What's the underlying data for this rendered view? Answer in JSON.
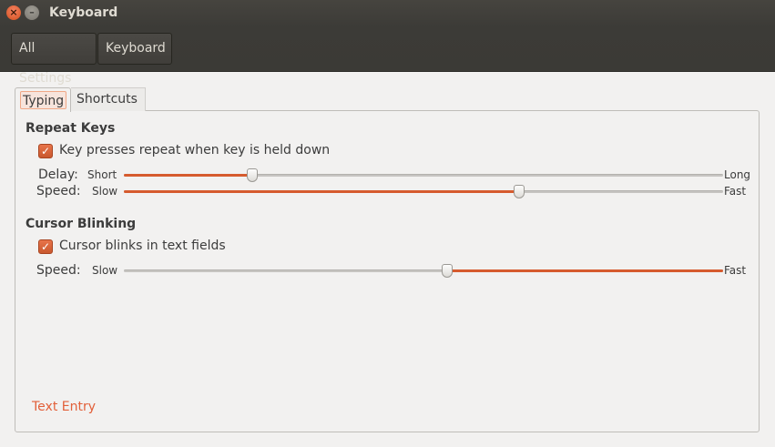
{
  "window": {
    "title": "Keyboard",
    "close_glyph": "×",
    "minimize_glyph": "–"
  },
  "breadcrumbs": {
    "all_settings": "All Settings",
    "keyboard": "Keyboard"
  },
  "tabs": [
    {
      "label": "Typing",
      "selected": true
    },
    {
      "label": "Shortcuts",
      "selected": false
    }
  ],
  "repeat_keys": {
    "title": "Repeat Keys",
    "checkbox_label": "Key presses repeat when key is held down",
    "checked": true,
    "delay": {
      "label": "Delay:",
      "min_label": "Short",
      "max_label": "Long",
      "value": 0.215
    },
    "speed": {
      "label": "Speed:",
      "min_label": "Slow",
      "max_label": "Fast",
      "value": 0.66
    }
  },
  "cursor_blinking": {
    "title": "Cursor Blinking",
    "checkbox_label": "Cursor blinks in text fields",
    "checked": true,
    "speed": {
      "label": "Speed:",
      "min_label": "Slow",
      "max_label": "Fast",
      "value": 0.54
    }
  },
  "footer_link": "Text Entry",
  "colors": {
    "accent": "#d65b2e",
    "titlebar": "#3c3b37",
    "background": "#f2f1f0"
  },
  "icons": {
    "close": "close-icon",
    "minimize": "minimize-icon",
    "check": "checkmark-icon"
  },
  "check_glyph": "✓"
}
